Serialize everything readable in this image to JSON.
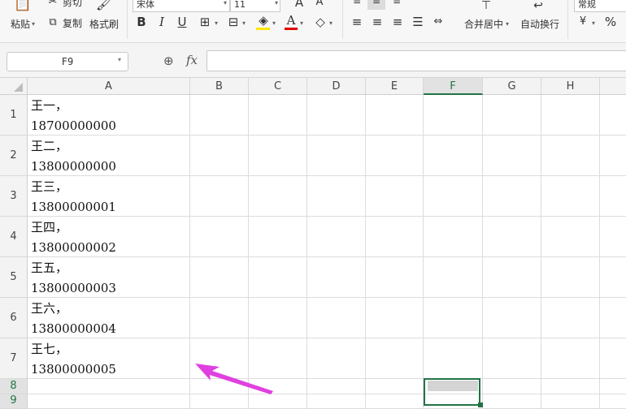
{
  "ribbon": {
    "paste_label": "粘贴",
    "cut_label": "剪切",
    "copy_label": "复制",
    "format_painter_label": "格式刷",
    "font_name": "宋体",
    "font_size": "11",
    "grow_font": "A",
    "shrink_font": "A",
    "bold": "B",
    "italic": "I",
    "underline": "U",
    "font_color_glyph": "A",
    "merge_center_label": "合并居中",
    "wrap_text_label": "自动换行",
    "number_format": "常规",
    "currency_glyph": "¥",
    "percent_glyph": "%"
  },
  "formula_bar": {
    "name_box": "F9",
    "fx": "fx",
    "formula": ""
  },
  "sheet": {
    "columns": [
      "A",
      "B",
      "C",
      "D",
      "E",
      "F",
      "G",
      "H"
    ],
    "selected_column": "F",
    "rows": [
      {
        "num": "1",
        "line1": "王一，",
        "line2": "18700000000"
      },
      {
        "num": "2",
        "line1": "王二，",
        "line2": "13800000000"
      },
      {
        "num": "3",
        "line1": "王三，",
        "line2": "13800000001"
      },
      {
        "num": "4",
        "line1": "王四，",
        "line2": "13800000002"
      },
      {
        "num": "5",
        "line1": "王五，",
        "line2": "13800000003"
      },
      {
        "num": "6",
        "line1": "王六，",
        "line2": "13800000004"
      },
      {
        "num": "7",
        "line1": "王七，",
        "line2": "13800000005"
      },
      {
        "num": "8",
        "line1": "",
        "line2": ""
      },
      {
        "num": "9",
        "line1": "",
        "line2": ""
      }
    ]
  },
  "colors": {
    "accent": "#217346",
    "arrow": "#e040e0"
  }
}
